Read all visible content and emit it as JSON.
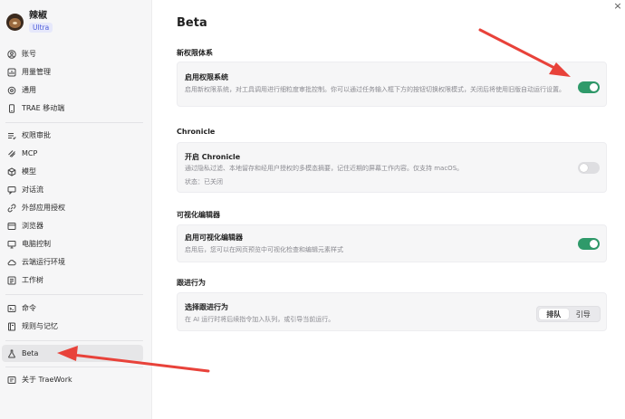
{
  "profile": {
    "username": "辣椒",
    "badge": "Ultra"
  },
  "sidebar": {
    "items": [
      {
        "label": "账号",
        "icon": "user-icon"
      },
      {
        "label": "用量管理",
        "icon": "usage-icon"
      },
      {
        "label": "通用",
        "icon": "gear-icon"
      },
      {
        "label": "TRAE 移动端",
        "icon": "mobile-icon"
      },
      {
        "label": "权限审批",
        "icon": "list-check-icon"
      },
      {
        "label": "MCP",
        "icon": "mcp-icon"
      },
      {
        "label": "模型",
        "icon": "cube-icon"
      },
      {
        "label": "对话流",
        "icon": "chat-flow-icon"
      },
      {
        "label": "外部应用授权",
        "icon": "link-icon"
      },
      {
        "label": "浏览器",
        "icon": "browser-icon"
      },
      {
        "label": "电脑控制",
        "icon": "monitor-icon"
      },
      {
        "label": "云端运行环境",
        "icon": "cloud-icon"
      },
      {
        "label": "工作树",
        "icon": "tree-icon"
      },
      {
        "label": "命令",
        "icon": "terminal-icon"
      },
      {
        "label": "规则与记忆",
        "icon": "book-icon"
      },
      {
        "label": "Beta",
        "icon": "flask-icon"
      },
      {
        "label": "关于 TraeWork",
        "icon": "info-icon"
      }
    ]
  },
  "main": {
    "title": "Beta",
    "sections": [
      {
        "title": "新权限体系",
        "card_title": "启用权限系统",
        "desc": "启用新权限系统，对工具调用进行细粒度审批控制。你可以通过任务输入框下方的按钮切换权限模式，关闭后将使用旧版自动运行设置。",
        "toggle": "on"
      },
      {
        "title": "Chronicle",
        "card_title": "开启 Chronicle",
        "desc": "通过隐私过滤、本地留存和经用户授权的多模态摘要，记住近期的屏幕工作内容。仅支持 macOS。",
        "status": "状态：已关闭",
        "toggle": "off"
      },
      {
        "title": "可视化编辑器",
        "card_title": "启用可视化编辑器",
        "desc": "启用后，您可以在网页预览中可视化检查和编辑元素样式",
        "toggle": "on"
      },
      {
        "title": "跟进行为",
        "card_title": "选择跟进行为",
        "desc": "在 AI 运行时将后续指令加入队列，或引导当前运行。",
        "options": [
          "排队",
          "引导"
        ],
        "selected": "排队"
      }
    ]
  },
  "window": {
    "close_label": "×"
  },
  "colors": {
    "toggle_on": "#2f9a6a",
    "toggle_off": "#dedee1",
    "annotation_arrow": "#e8423a",
    "badge_text": "#4c5bd8"
  }
}
